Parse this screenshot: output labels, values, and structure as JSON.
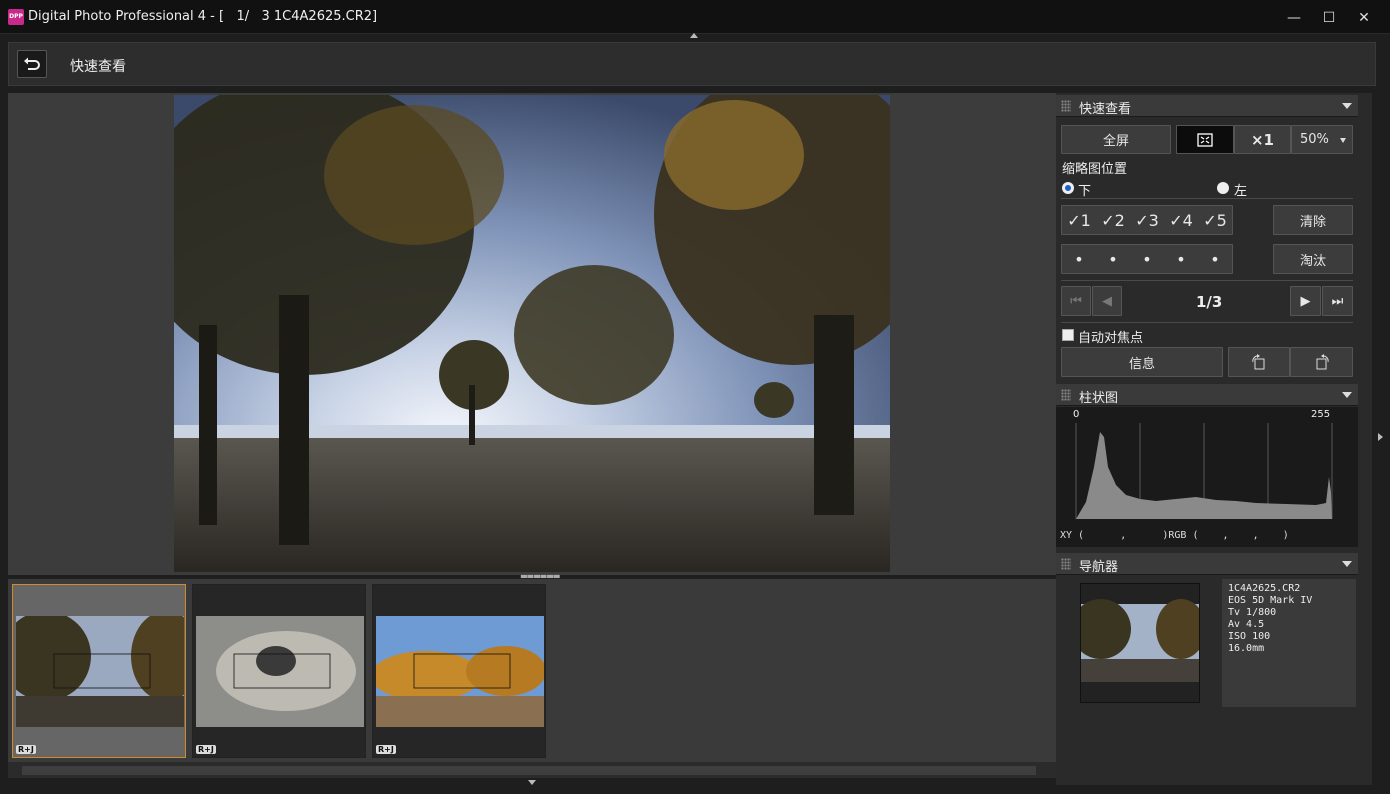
{
  "window": {
    "icon_text": "DPP",
    "title": "Digital Photo Professional 4 - [   1/   3 1C4A2625.CR2]",
    "minimize": "—",
    "maximize": "☐",
    "close": "✕"
  },
  "toolbar": {
    "back_icon": "undo-arrow-icon",
    "title": "快速查看"
  },
  "thumbnails": [
    {
      "badge": "R+J",
      "selected": true
    },
    {
      "badge": "R+J",
      "selected": false
    },
    {
      "badge": "R+J",
      "selected": false
    }
  ],
  "quick_view_panel": {
    "title": "快速查看",
    "fullscreen_label": "全屏",
    "fit_icon": "fit-screen-icon",
    "zoom_1x_label": "×1",
    "zoom_select_value": "50%",
    "thumb_position_label": "缩略图位置",
    "pos_bottom_label": "下",
    "pos_left_label": "左",
    "checkmarks": [
      "✓1",
      "✓2",
      "✓3",
      "✓4",
      "✓5"
    ],
    "clear_label": "清除",
    "rating_dots": [
      "•",
      "•",
      "•",
      "•",
      "•"
    ],
    "reject_label": "淘汰",
    "page_indicator": "1/3",
    "auto_focus_label": "自动对焦点",
    "info_label": "信息"
  },
  "histogram_panel": {
    "title": "柱状图",
    "axis_min": "0",
    "axis_max": "255",
    "xy_readout": "XY (      ,      )RGB (    ,    ,    )"
  },
  "navigator_panel": {
    "title": "导航器",
    "info_lines": [
      "1C4A2625.CR2",
      "EOS 5D Mark IV",
      "Tv 1/800",
      "Av 4.5",
      "ISO 100",
      "16.0mm"
    ]
  },
  "colors": {
    "accent_selected": "#d08a28",
    "radio_selected": "#1a5fd0"
  }
}
